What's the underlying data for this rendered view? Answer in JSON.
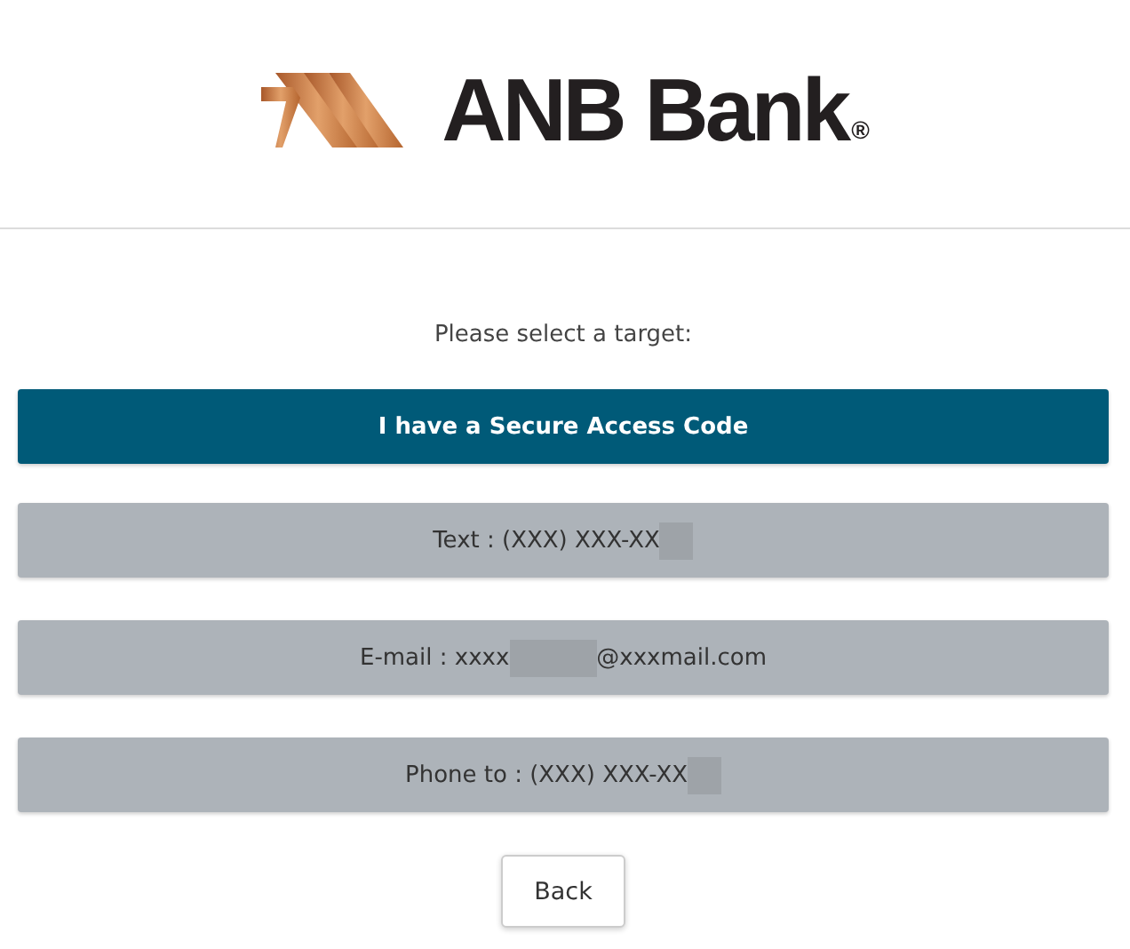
{
  "header": {
    "logo": {
      "name": "ANB Bank",
      "mark": "®"
    }
  },
  "prompt": "Please select a target:",
  "options": [
    {
      "kind": "primary",
      "label": "I have a Secure Access Code"
    },
    {
      "kind": "secondary",
      "label": "Text : (XXX) XXX-XX",
      "redacted": true
    },
    {
      "kind": "secondary",
      "label": "E-mail : xxxx",
      "redacted": true,
      "after": "@xxxmail.com"
    },
    {
      "kind": "secondary",
      "label": "Phone to : (XXX) XXX-XX",
      "redacted": true
    }
  ],
  "back_button": "Back"
}
